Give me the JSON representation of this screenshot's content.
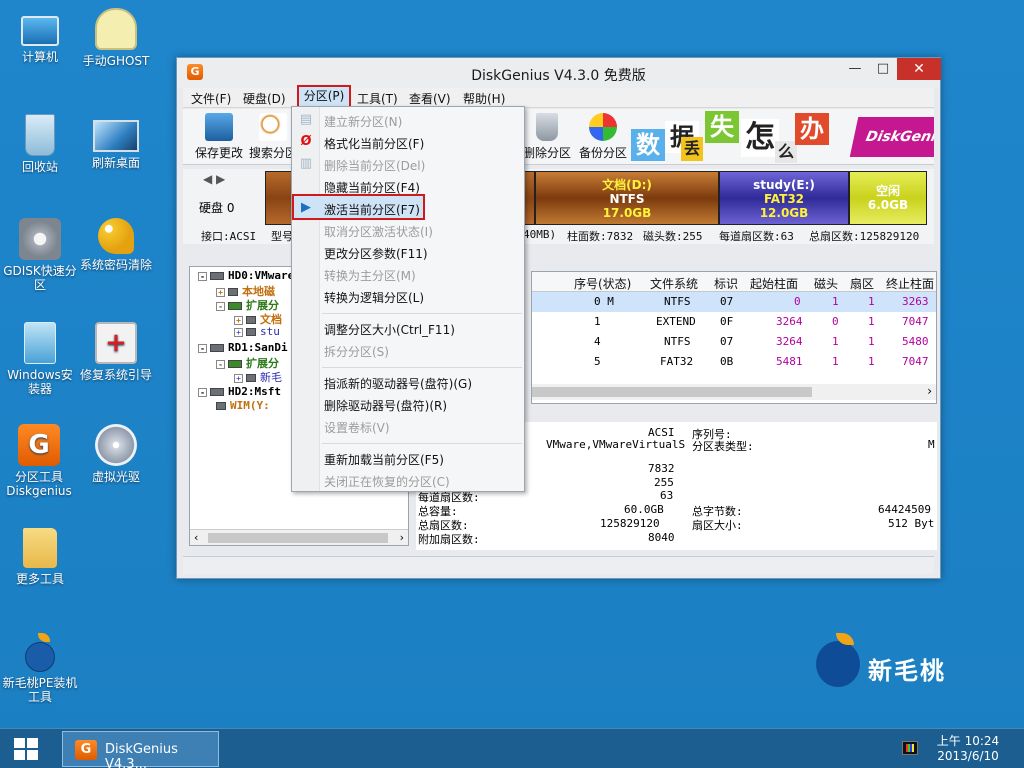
{
  "desktop": {
    "icons": [
      {
        "label": "计算机"
      },
      {
        "label": "手动GHOST"
      },
      {
        "label": "回收站"
      },
      {
        "label": "刷新桌面"
      },
      {
        "label": "GDISK快速分区"
      },
      {
        "label": "系统密码清除"
      },
      {
        "label": "Windows安装器"
      },
      {
        "label": "修复系统引导"
      },
      {
        "label": "分区工具Diskgenius"
      },
      {
        "label": "虚拟光驱"
      },
      {
        "label": "更多工具"
      },
      {
        "label": "新毛桃PE装机工具"
      }
    ],
    "brand_text": "新毛桃"
  },
  "window": {
    "title": "DiskGenius V4.3.0 免费版",
    "app_icon": "G",
    "controls": {
      "minimize": "—",
      "maximize": "□",
      "close": "✕"
    }
  },
  "menubar": {
    "items": [
      "文件(F)",
      "硬盘(D)",
      "分区(P)",
      "工具(T)",
      "查看(V)",
      "帮助(H)"
    ]
  },
  "toolbar": {
    "save": "保存更改",
    "search": "搜索分区",
    "delete": "删除分区",
    "backup": "备份分区",
    "banner_chars": [
      "数",
      "据",
      "丢",
      "失",
      "怎",
      "么",
      "办"
    ],
    "banner_logo": "DiskGenius"
  },
  "diskbar": {
    "nav": "◀ ▶",
    "disk_label": "硬盘 0",
    "partitions": [
      {
        "name": "",
        "fs": "",
        "size": ""
      },
      {
        "name": "文档(D:)",
        "fs": "NTFS",
        "size": "17.0GB"
      },
      {
        "name": "study(E:)",
        "fs": "FAT32",
        "size": "12.0GB"
      },
      {
        "name": "空闲",
        "fs": "",
        "size": "6.0GB"
      }
    ]
  },
  "infoline": {
    "iface": "接口:ACSI",
    "model": "型号",
    "capacity": "40MB)",
    "cylinders": "柱面数:7832",
    "heads": "磁头数:255",
    "sectors": "每道扇区数:63",
    "total": "总扇区数:125829120"
  },
  "tree": {
    "nodes": [
      "HD0:VMware",
      "本地磁",
      "扩展分",
      "文档",
      "stu",
      "RD1:SanDi",
      "扩展分",
      "新毛",
      "HD2:Msft",
      "WIM(Y:"
    ]
  },
  "grid": {
    "headers": [
      "序号(状态)",
      "文件系统",
      "标识",
      "起始柱面",
      "磁头",
      "扇区",
      "终止柱面"
    ],
    "rows": [
      {
        "seq": "0 M",
        "fs": "NTFS",
        "id": "07",
        "start": "0",
        "head": "1",
        "sector": "1",
        "end": "3263"
      },
      {
        "seq": "1",
        "fs": "EXTEND",
        "id": "0F",
        "start": "3264",
        "head": "0",
        "sector": "1",
        "end": "7047"
      },
      {
        "seq": "4",
        "fs": "NTFS",
        "id": "07",
        "start": "3264",
        "head": "1",
        "sector": "1",
        "end": "5480"
      },
      {
        "seq": "5",
        "fs": "FAT32",
        "id": "0B",
        "start": "5481",
        "head": "1",
        "sector": "1",
        "end": "7047"
      }
    ]
  },
  "detail": {
    "iface_val": "ACSI",
    "model_val": "VMware,VMwareVirtualS",
    "serial_label": "序列号:",
    "ptype_label": "分区表类型:",
    "ptype_val": "M",
    "cyl_val": "7832",
    "head_val": "255",
    "spt_label": "每道扇区数:",
    "spt_val": "63",
    "cap_label": "总容量:",
    "cap_val": "60.0GB",
    "bytes_label": "总字节数:",
    "bytes_val": "64424509",
    "tsec_label": "总扇区数:",
    "tsec_val": "125829120",
    "ssize_label": "扇区大小:",
    "ssize_val": "512 Byt",
    "extra_label": "附加扇区数:",
    "extra_val": "8040"
  },
  "dropdown": {
    "items": [
      {
        "label": "建立新分区(N)",
        "enabled": false
      },
      {
        "label": "格式化当前分区(F)",
        "enabled": true
      },
      {
        "label": "删除当前分区(Del)",
        "enabled": false
      },
      {
        "label": "隐藏当前分区(F4)",
        "enabled": true
      },
      {
        "label": "激活当前分区(F7)",
        "enabled": true
      },
      {
        "label": "取消分区激活状态(I)",
        "enabled": false
      },
      {
        "label": "更改分区参数(F11)",
        "enabled": true
      },
      {
        "label": "转换为主分区(M)",
        "enabled": false
      },
      {
        "label": "转换为逻辑分区(L)",
        "enabled": true
      },
      {
        "label": "调整分区大小(Ctrl_F11)",
        "enabled": true
      },
      {
        "label": "拆分分区(S)",
        "enabled": false
      },
      {
        "label": "指派新的驱动器号(盘符)(G)",
        "enabled": true
      },
      {
        "label": "删除驱动器号(盘符)(R)",
        "enabled": true
      },
      {
        "label": "设置卷标(V)",
        "enabled": false
      },
      {
        "label": "重新加载当前分区(F5)",
        "enabled": true
      },
      {
        "label": "关闭正在恢复的分区(C)",
        "enabled": false
      }
    ]
  },
  "taskbar": {
    "task_label": "DiskGenius V4.3...",
    "time": "上午 10:24",
    "date": "2013/6/10"
  },
  "colors": {
    "desktop": "#1e84c8",
    "highlight_border": "#d0191b",
    "close_button": "#c7312a",
    "ntfs_segment": "#8a4314",
    "fat32_segment": "#2f2a98",
    "free_segment": "#c9d21d"
  }
}
